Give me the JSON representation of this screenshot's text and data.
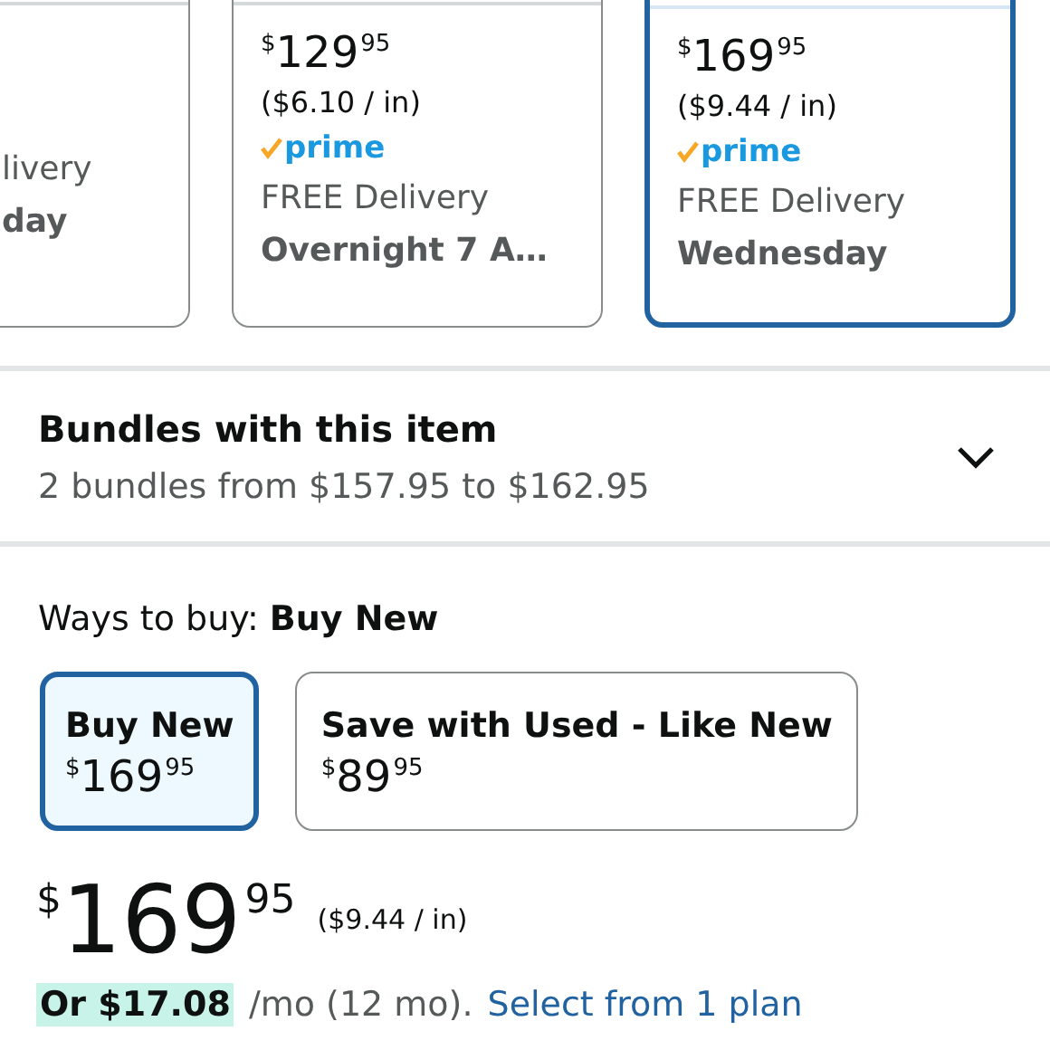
{
  "offers": [
    {
      "selected": false,
      "delivery": "livery",
      "delivery_date": "day"
    },
    {
      "selected": false,
      "price": {
        "symbol": "$",
        "whole": "129",
        "fraction": "95"
      },
      "unit_price": "($6.10 / in)",
      "prime": "prime",
      "delivery": "FREE Delivery",
      "delivery_date": "Overnight 7 A…"
    },
    {
      "selected": true,
      "price": {
        "symbol": "$",
        "whole": "169",
        "fraction": "95"
      },
      "unit_price": "($9.44 / in)",
      "prime": "prime",
      "delivery": "FREE Delivery",
      "delivery_date": "Wednesday"
    }
  ],
  "bundles": {
    "title": "Bundles with this item",
    "subtitle": "2 bundles from $157.95 to $162.95",
    "expanded": false
  },
  "ways_to_buy": {
    "label": "Ways to buy:",
    "value": "Buy New",
    "options": [
      {
        "label": "Buy New",
        "price": {
          "symbol": "$",
          "whole": "169",
          "fraction": "95"
        },
        "selected": true
      },
      {
        "label": "Save with Used - Like New",
        "price": {
          "symbol": "$",
          "whole": "89",
          "fraction": "95"
        },
        "selected": false
      }
    ]
  },
  "price": {
    "symbol": "$",
    "whole": "169",
    "fraction": "95"
  },
  "unit_price": "($9.44 / in)",
  "installment": {
    "amount": "Or $17.08",
    "terms": "/mo (12 mo).",
    "link": "Select from 1 plan"
  }
}
